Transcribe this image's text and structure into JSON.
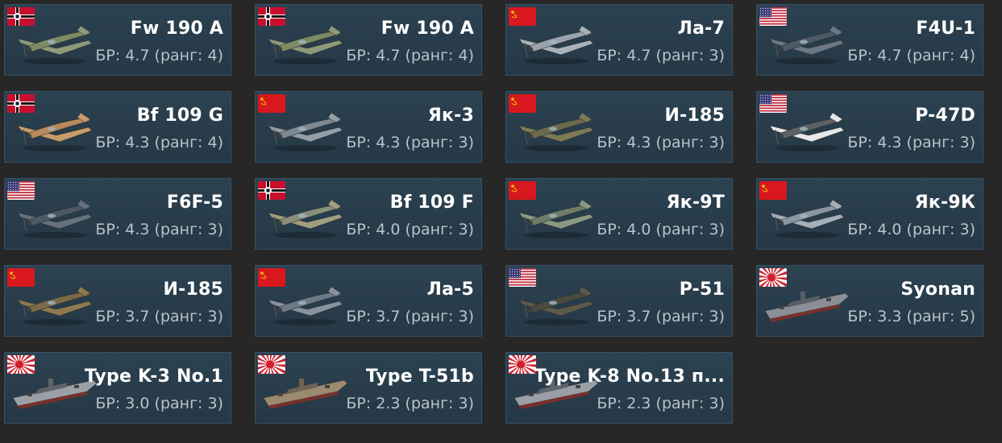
{
  "br_prefix": "БР:",
  "vehicles": [
    {
      "name": "Fw 190 A",
      "br": "БР: 4.7 (ранг: 4)",
      "nation": "germany",
      "type": "plane",
      "colors": {
        "body": "#7d8b64",
        "wing": "#8e9a78"
      }
    },
    {
      "name": "Fw 190 A",
      "br": "БР: 4.7 (ранг: 4)",
      "nation": "germany",
      "type": "plane",
      "colors": {
        "body": "#7d8b64",
        "wing": "#8e9a78"
      }
    },
    {
      "name": "Ла-7",
      "br": "БР: 4.7 (ранг: 3)",
      "nation": "ussr",
      "type": "plane",
      "colors": {
        "body": "#9aa3ab",
        "wing": "#aab2b9"
      }
    },
    {
      "name": "F4U-1",
      "br": "БР: 4.7 (ранг: 4)",
      "nation": "usa",
      "type": "plane",
      "colors": {
        "body": "#4c5a66",
        "wing": "#6b7782"
      }
    },
    {
      "name": "Bf 109 G",
      "br": "БР: 4.3 (ранг: 4)",
      "nation": "germany",
      "type": "plane",
      "colors": {
        "body": "#b8895a",
        "wing": "#c89b6a"
      }
    },
    {
      "name": "Як-3",
      "br": "БР: 4.3 (ранг: 3)",
      "nation": "ussr",
      "type": "plane",
      "colors": {
        "body": "#7d8891",
        "wing": "#939ea6"
      }
    },
    {
      "name": "И-185",
      "br": "БР: 4.3 (ранг: 3)",
      "nation": "ussr",
      "type": "plane",
      "colors": {
        "body": "#6b6a4c",
        "wing": "#7e7a55"
      }
    },
    {
      "name": "P-47D",
      "br": "БР: 4.3 (ранг: 3)",
      "nation": "usa",
      "type": "plane",
      "colors": {
        "body": "#5b6165",
        "wing": "#e8e8e8"
      }
    },
    {
      "name": "F6F-5",
      "br": "БР: 4.3 (ранг: 3)",
      "nation": "usa",
      "type": "plane",
      "colors": {
        "body": "#4d5a66",
        "wing": "#65717c"
      }
    },
    {
      "name": "Bf 109 F",
      "br": "БР: 4.0 (ранг: 3)",
      "nation": "germany",
      "type": "plane",
      "colors": {
        "body": "#8a8f7a",
        "wing": "#a19f80"
      }
    },
    {
      "name": "Як-9Т",
      "br": "БР: 4.0 (ранг: 3)",
      "nation": "ussr",
      "type": "plane",
      "colors": {
        "body": "#6f7c68",
        "wing": "#8a9884"
      }
    },
    {
      "name": "Як-9К",
      "br": "БР: 4.0 (ранг: 3)",
      "nation": "ussr",
      "type": "plane",
      "colors": {
        "body": "#8a96a0",
        "wing": "#a4afb8"
      }
    },
    {
      "name": "И-185",
      "br": "БР: 3.7 (ранг: 3)",
      "nation": "ussr",
      "type": "plane",
      "colors": {
        "body": "#7a6a45",
        "wing": "#8e7a4e"
      }
    },
    {
      "name": "Ла-5",
      "br": "БР: 3.7 (ранг: 3)",
      "nation": "ussr",
      "type": "plane",
      "colors": {
        "body": "#6e7a86",
        "wing": "#88939d"
      }
    },
    {
      "name": "P-51",
      "br": "БР: 3.7 (ранг: 3)",
      "nation": "usa",
      "type": "plane",
      "colors": {
        "body": "#4a4a3e",
        "wing": "#5c5a48"
      }
    },
    {
      "name": "Syonan",
      "br": "БР: 3.3 (ранг: 5)",
      "nation": "japan",
      "type": "ship",
      "colors": {
        "body": "#8a8f96",
        "wing": "#5a5f66"
      }
    },
    {
      "name": "Type K-3 No.1",
      "br": "БР: 3.0 (ранг: 3)",
      "nation": "japan",
      "type": "ship",
      "colors": {
        "body": "#9ba0a6",
        "wing": "#5f646a"
      }
    },
    {
      "name": "Type T-51b",
      "br": "БР: 2.3 (ранг: 3)",
      "nation": "japan",
      "type": "ship",
      "colors": {
        "body": "#9c8a70",
        "wing": "#6e6250"
      }
    },
    {
      "name": "Type K-8 No.13 п...",
      "br": "БР: 2.3 (ранг: 3)",
      "nation": "japan",
      "type": "ship",
      "colors": {
        "body": "#9ba0a6",
        "wing": "#5f646a"
      }
    }
  ]
}
